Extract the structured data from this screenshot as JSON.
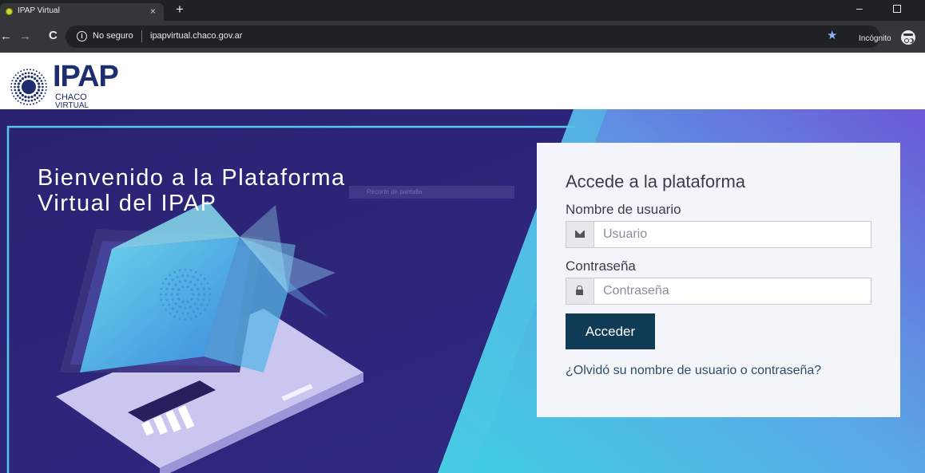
{
  "browser": {
    "tab_title": "IPAP Virtual",
    "tab_close": "×",
    "new_tab": "+",
    "minimize": "–",
    "nav_back": "←",
    "nav_forward": "→",
    "reload": "C",
    "security_text": "No seguro",
    "url": "ipapvirtual.chaco.gov.ar",
    "bookmark_star": "★",
    "incognito_label": "Incógnito",
    "icons": [
      "favicon-icon",
      "info-icon",
      "star-icon",
      "incognito-icon"
    ]
  },
  "site": {
    "logo_main": "IPAP",
    "logo_sub1": "CHACO",
    "logo_sub2": "VIRTUAL"
  },
  "hero": {
    "title_line1": "Bienvenido a la Plataforma",
    "title_line2": "Virtual del IPAP",
    "ghost_text": "Recorte de pantalla"
  },
  "login": {
    "title": "Accede a la plataforma",
    "username_label": "Nombre de usuario",
    "username_placeholder": "Usuario",
    "password_label": "Contraseña",
    "password_placeholder": "Contraseña",
    "submit_label": "Acceder",
    "forgot_link": "¿Olvidó su nombre de usuario o contraseña?"
  },
  "colors": {
    "hero_dark": "#2d2470",
    "hero_cyan": "#5ec6e4",
    "hero_purple": "#6a5fd6",
    "button": "#0f3b56",
    "logo": "#1d2d6e"
  }
}
